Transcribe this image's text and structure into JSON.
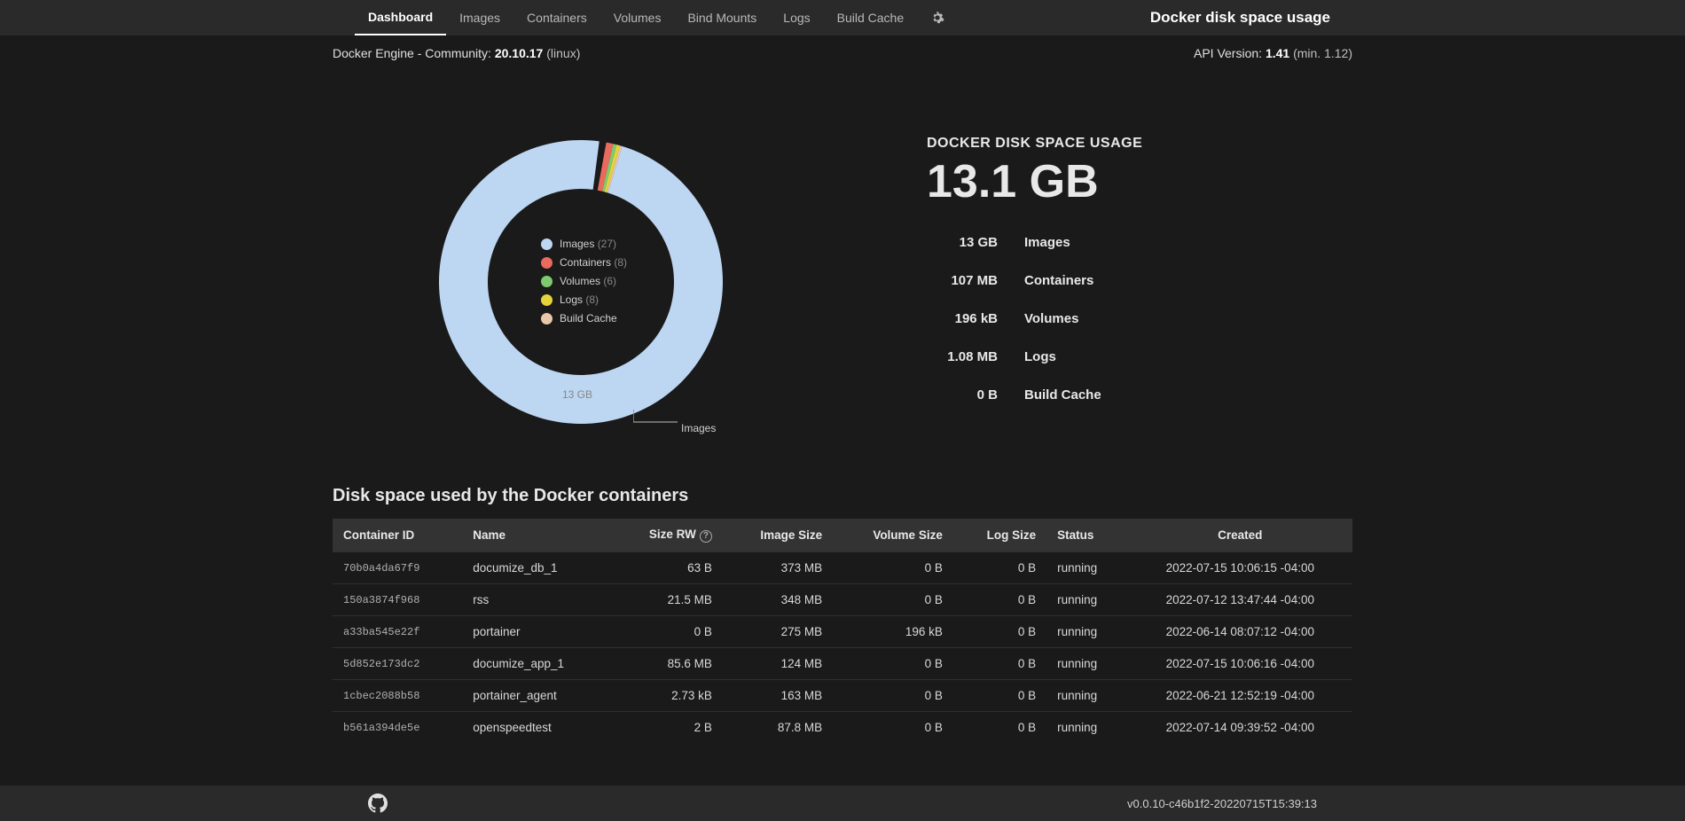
{
  "header": {
    "tabs": [
      "Dashboard",
      "Images",
      "Containers",
      "Volumes",
      "Bind Mounts",
      "Logs",
      "Build Cache"
    ],
    "active_tab": "Dashboard",
    "title_right": "Docker disk space usage"
  },
  "engine_info": {
    "prefix": "Docker Engine - Community: ",
    "version": "20.10.17",
    "suffix": " (linux)"
  },
  "api_info": {
    "prefix": "API Version: ",
    "version": "1.41",
    "suffix": " (min. 1.12)"
  },
  "chart_data": {
    "type": "pie",
    "title": "",
    "series": [
      {
        "name": "Images",
        "label": "Images",
        "count": 27,
        "value_bytes": 13000000000,
        "display": "13 GB",
        "color": "#bdd6f2"
      },
      {
        "name": "Containers",
        "label": "Containers",
        "count": 8,
        "value_bytes": 107000000,
        "display": "107 MB",
        "color": "#ea6a5c"
      },
      {
        "name": "Volumes",
        "label": "Volumes",
        "count": 6,
        "value_bytes": 196000,
        "display": "196 kB",
        "color": "#7ecb6f"
      },
      {
        "name": "Logs",
        "label": "Logs",
        "count": 8,
        "value_bytes": 1080000,
        "display": "1.08 MB",
        "color": "#e6d23a"
      },
      {
        "name": "Build Cache",
        "label": "Build Cache",
        "count": null,
        "value_bytes": 0,
        "display": "0 B",
        "color": "#e8c8a8"
      }
    ],
    "center_label": "13 GB",
    "leader_label": "Images"
  },
  "summary": {
    "title": "DOCKER DISK SPACE USAGE",
    "total": "13.1 GB",
    "rows": [
      {
        "size": "13 GB",
        "label": "Images"
      },
      {
        "size": "107 MB",
        "label": "Containers"
      },
      {
        "size": "196 kB",
        "label": "Volumes"
      },
      {
        "size": "1.08 MB",
        "label": "Logs"
      },
      {
        "size": "0 B",
        "label": "Build Cache"
      }
    ]
  },
  "containers_section": {
    "title": "Disk space used by the Docker containers",
    "columns": [
      "Container ID",
      "Name",
      "Size RW",
      "Image Size",
      "Volume Size",
      "Log Size",
      "Status",
      "Created"
    ],
    "rows": [
      {
        "id": "70b0a4da67f9",
        "name": "documize_db_1",
        "size_rw": "63 B",
        "image_size": "373 MB",
        "volume_size": "0 B",
        "log_size": "0 B",
        "status": "running",
        "created": "2022-07-15  10:06:15 -04:00"
      },
      {
        "id": "150a3874f968",
        "name": "rss",
        "size_rw": "21.5 MB",
        "image_size": "348 MB",
        "volume_size": "0 B",
        "log_size": "0 B",
        "status": "running",
        "created": "2022-07-12  13:47:44 -04:00"
      },
      {
        "id": "a33ba545e22f",
        "name": "portainer",
        "size_rw": "0 B",
        "image_size": "275 MB",
        "volume_size": "196 kB",
        "log_size": "0 B",
        "status": "running",
        "created": "2022-06-14  08:07:12 -04:00"
      },
      {
        "id": "5d852e173dc2",
        "name": "documize_app_1",
        "size_rw": "85.6 MB",
        "image_size": "124 MB",
        "volume_size": "0 B",
        "log_size": "0 B",
        "status": "running",
        "created": "2022-07-15  10:06:16 -04:00"
      },
      {
        "id": "1cbec2088b58",
        "name": "portainer_agent",
        "size_rw": "2.73 kB",
        "image_size": "163 MB",
        "volume_size": "0 B",
        "log_size": "0 B",
        "status": "running",
        "created": "2022-06-21  12:52:19 -04:00"
      },
      {
        "id": "b561a394de5e",
        "name": "openspeedtest",
        "size_rw": "2 B",
        "image_size": "87.8 MB",
        "volume_size": "0 B",
        "log_size": "0 B",
        "status": "running",
        "created": "2022-07-14  09:39:52 -04:00"
      }
    ]
  },
  "footer": {
    "version": "v0.0.10-c46b1f2-20220715T15:39:13"
  }
}
